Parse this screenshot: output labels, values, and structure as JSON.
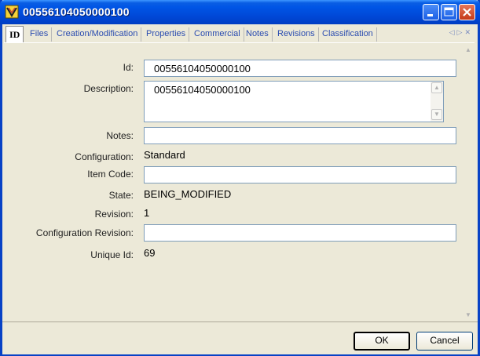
{
  "window": {
    "title": "00556104050000100"
  },
  "tabs": [
    {
      "label": "ID"
    },
    {
      "label": "Files"
    },
    {
      "label": "Creation/Modification"
    },
    {
      "label": "Properties"
    },
    {
      "label": "Commercial"
    },
    {
      "label": "Notes"
    },
    {
      "label": "Revisions"
    },
    {
      "label": "Classification"
    }
  ],
  "tab_scroll": {
    "left": "◁",
    "right": "▷",
    "close": "✕"
  },
  "form": {
    "id_label": "Id:",
    "id_value": "00556104050000100",
    "description_label": "Description:",
    "description_value": "00556104050000100",
    "notes_label": "Notes:",
    "notes_value": "",
    "configuration_label": "Configuration:",
    "configuration_value": "Standard",
    "item_code_label": "Item Code:",
    "item_code_value": "",
    "state_label": "State:",
    "state_value": "BEING_MODIFIED",
    "revision_label": "Revision:",
    "revision_value": "1",
    "config_revision_label": "Configuration Revision:",
    "config_revision_value": "",
    "unique_id_label": "Unique Id:",
    "unique_id_value": "69"
  },
  "buttons": {
    "ok": "OK",
    "cancel": "Cancel"
  }
}
